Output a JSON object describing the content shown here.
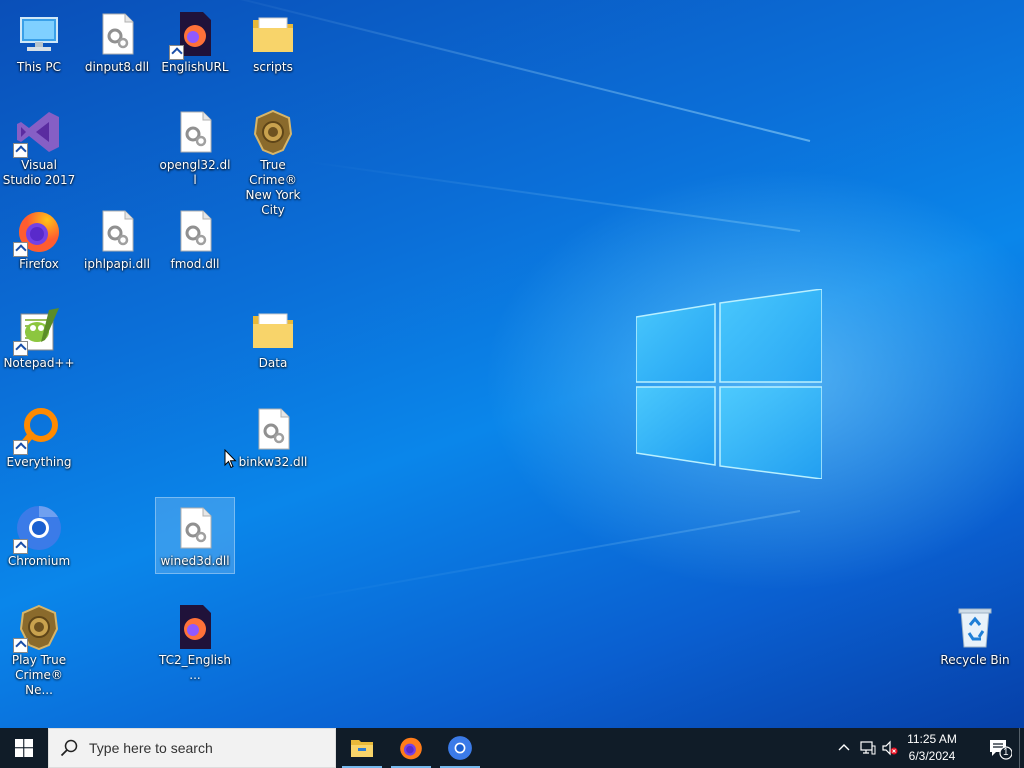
{
  "desktop": {
    "icons": [
      {
        "label": "This PC",
        "icon": "this-pc-icon"
      },
      {
        "label": "dinput8.dll",
        "icon": "dll-file-icon"
      },
      {
        "label": "EnglishURL",
        "icon": "firefox-document-icon"
      },
      {
        "label": "scripts",
        "icon": "folder-icon"
      },
      {
        "label": "Visual Studio 2017",
        "icon": "visual-studio-icon"
      },
      {
        "label": "opengl32.dll",
        "icon": "dll-file-icon"
      },
      {
        "label": "True Crime® New York City",
        "icon": "true-crime-badge-icon"
      },
      {
        "label": "Firefox",
        "icon": "firefox-icon"
      },
      {
        "label": "iphlpapi.dll",
        "icon": "dll-file-icon"
      },
      {
        "label": "fmod.dll",
        "icon": "dll-file-icon"
      },
      {
        "label": "Notepad++",
        "icon": "notepad-plus-plus-icon"
      },
      {
        "label": "Data",
        "icon": "folder-icon"
      },
      {
        "label": "Everything",
        "icon": "everything-search-icon"
      },
      {
        "label": "binkw32.dll",
        "icon": "dll-file-icon"
      },
      {
        "label": "Chromium",
        "icon": "chromium-icon"
      },
      {
        "label": "wined3d.dll",
        "icon": "dll-file-icon"
      },
      {
        "label": "Play True Crime® Ne...",
        "icon": "true-crime-badge-icon"
      },
      {
        "label": "TC2_English...",
        "icon": "firefox-document-icon"
      },
      {
        "label": "Recycle Bin",
        "icon": "recycle-bin-icon"
      }
    ]
  },
  "taskbar": {
    "search_placeholder": "Type here to search",
    "pinned_apps": [
      "file-explorer-icon",
      "firefox-icon",
      "chromium-icon"
    ],
    "clock": {
      "time": "11:25 AM",
      "date": "6/3/2024"
    },
    "notification_count": "1"
  },
  "colors": {
    "taskbar_bg": "#101c28",
    "desktop_blue": "#0a6fd8",
    "accent": "#76b9ed"
  }
}
